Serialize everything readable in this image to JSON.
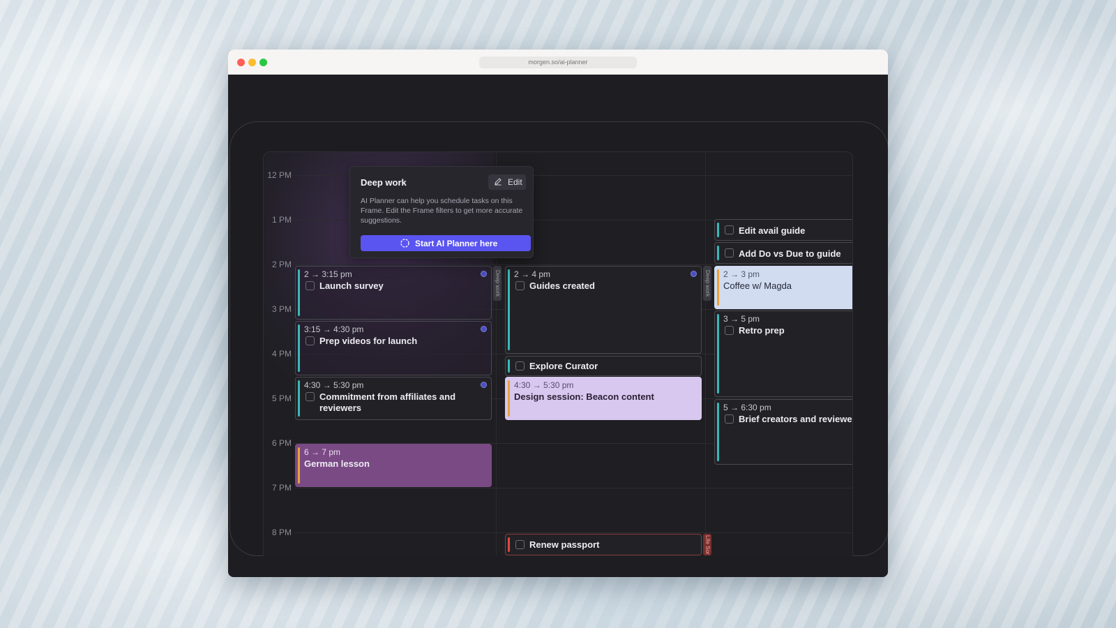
{
  "browser": {
    "url": "morgen.so/ai-planner"
  },
  "hours": [
    "12 PM",
    "1 PM",
    "2 PM",
    "3 PM",
    "4 PM",
    "5 PM",
    "6 PM",
    "7 PM",
    "8 PM"
  ],
  "popover": {
    "title": "Deep work",
    "edit_label": "Edit",
    "description": "AI Planner can help you schedule tasks on this Frame. Edit the Frame filters to get more accurate suggestions.",
    "start_label": "Start AI Planner here"
  },
  "frame_tags": {
    "deep_work": "Deep work",
    "life": "Life Sor"
  },
  "events": {
    "launch_survey": {
      "time": "2 → 3:15 pm",
      "title": "Launch survey"
    },
    "prep_videos": {
      "time": "3:15 → 4:30 pm",
      "title": "Prep videos for launch"
    },
    "commitment": {
      "time": "4:30 → 5:30 pm",
      "title": "Commitment from affiliates and reviewers"
    },
    "german": {
      "time": "6 → 7 pm",
      "title": "German lesson"
    },
    "guides": {
      "time": "2 → 4 pm",
      "title": "Guides created"
    },
    "explore": {
      "title": "Explore Curator"
    },
    "design": {
      "time": "4:30 → 5:30 pm",
      "title": "Design session: Beacon content"
    },
    "passport": {
      "title": "Renew passport"
    },
    "edit_avail": {
      "title": "Edit avail guide"
    },
    "do_vs_due": {
      "title": "Add Do vs Due to guide"
    },
    "coffee": {
      "time": "2 → 3 pm",
      "title": "Coffee w/ Magda"
    },
    "retro": {
      "time": "3 → 5 pm",
      "title": "Retro prep"
    },
    "brief": {
      "time": "5 → 6:30 pm",
      "title": "Brief creators and reviewers"
    }
  },
  "colors": {
    "accent": "#5a54f0",
    "teal_bar": "#3bb8b8",
    "orange_bar": "#e8a23a",
    "red_bar": "#e0483e",
    "german_bg": "#7a4a85",
    "design_bg": "#d8c8f0",
    "coffee_bg": "#d2dcf0"
  }
}
